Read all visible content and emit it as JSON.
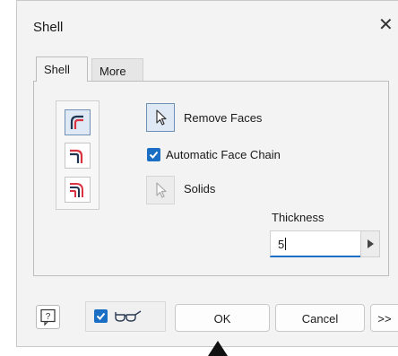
{
  "dialog": {
    "title": "Shell"
  },
  "tabs": [
    {
      "label": "Shell"
    },
    {
      "label": "More"
    }
  ],
  "shell": {
    "remove_faces_label": "Remove Faces",
    "automatic_face_chain_label": "Automatic Face Chain",
    "automatic_face_chain_checked": true,
    "solids_label": "Solids",
    "thickness_label": "Thickness",
    "thickness_value": "5"
  },
  "footer": {
    "preview_checked": true,
    "ok_label": "OK",
    "cancel_label": "Cancel",
    "more_label": ">>"
  },
  "icons": {
    "help": "help-icon",
    "preview": "glasses-icon",
    "close": "close-icon",
    "direction_inside": "shell-inside-icon",
    "direction_outside": "shell-outside-icon",
    "direction_both": "shell-both-icon",
    "cursor": "cursor-icon",
    "arrow": "play-arrow-icon"
  },
  "colors": {
    "accent": "#1a6fc4",
    "selected_tool_bg": "#dfe9f5",
    "icon_red": "#d93340"
  }
}
